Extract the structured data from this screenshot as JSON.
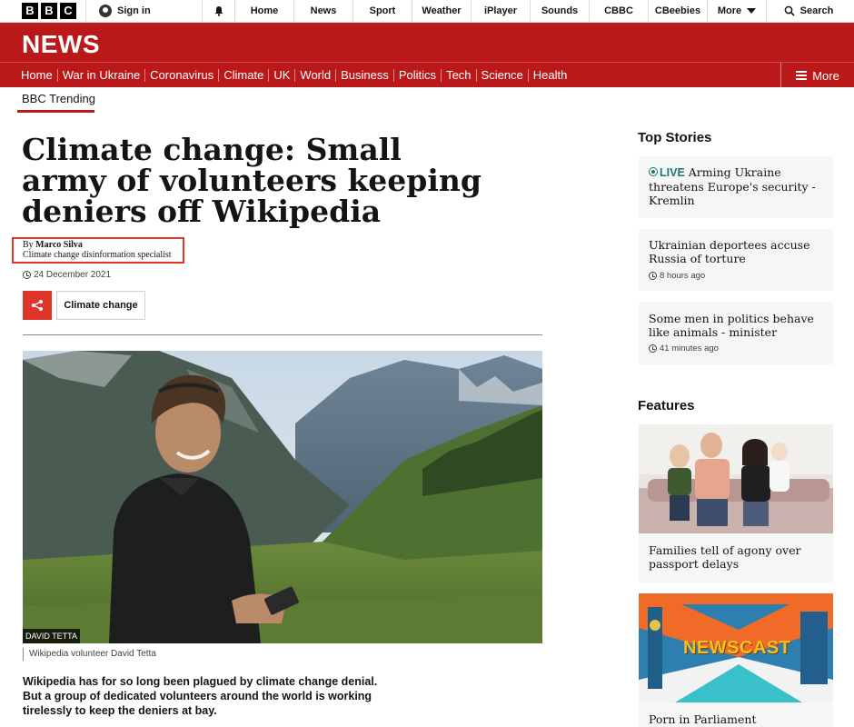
{
  "brand": {
    "letters": [
      "B",
      "B",
      "C"
    ],
    "section_title": "NEWS"
  },
  "topbar": {
    "sign_in": "Sign in",
    "items": [
      "Home",
      "News",
      "Sport",
      "Weather",
      "iPlayer",
      "Sounds",
      "CBBC",
      "CBeebies",
      "More"
    ],
    "search": "Search"
  },
  "section_nav": {
    "items": [
      "Home",
      "War in Ukraine",
      "Coronavirus",
      "Climate",
      "UK",
      "World",
      "Business",
      "Politics",
      "Tech",
      "Science",
      "Health"
    ],
    "more": "More"
  },
  "subsection": "BBC Trending",
  "article": {
    "headline": "Climate change: Small army of volunteers keeping deniers off Wikipedia",
    "byline_prefix": "By ",
    "author": "Marco Silva",
    "author_role": "Climate change disinformation specialist",
    "date": "24 December 2021",
    "tag": "Climate change",
    "image_credit": "DAVID TETTA",
    "image_caption": "Wikipedia volunteer David Tetta",
    "lead": "Wikipedia has for so long been plagued by climate change denial. But a group of dedicated volunteers around the world is working tirelessly to keep the deniers at bay."
  },
  "top_stories": {
    "title": "Top Stories",
    "items": [
      {
        "live": "LIVE",
        "headline": "Arming Ukraine threatens Europe's security - Kremlin",
        "time": ""
      },
      {
        "live": "",
        "headline": "Ukrainian deportees accuse Russia of torture",
        "time": "8 hours ago"
      },
      {
        "live": "",
        "headline": "Some men in politics behave like animals - minister",
        "time": "41 minutes ago"
      }
    ]
  },
  "features": {
    "title": "Features",
    "items": [
      {
        "headline": "Families tell of agony over passport delays"
      },
      {
        "headline": "Porn in Parliament",
        "image_text": "NEWSCAST"
      }
    ]
  },
  "colors": {
    "brand_red": "#bb1919",
    "share_red": "#e0352a",
    "live_green": "#1a7a6d"
  }
}
